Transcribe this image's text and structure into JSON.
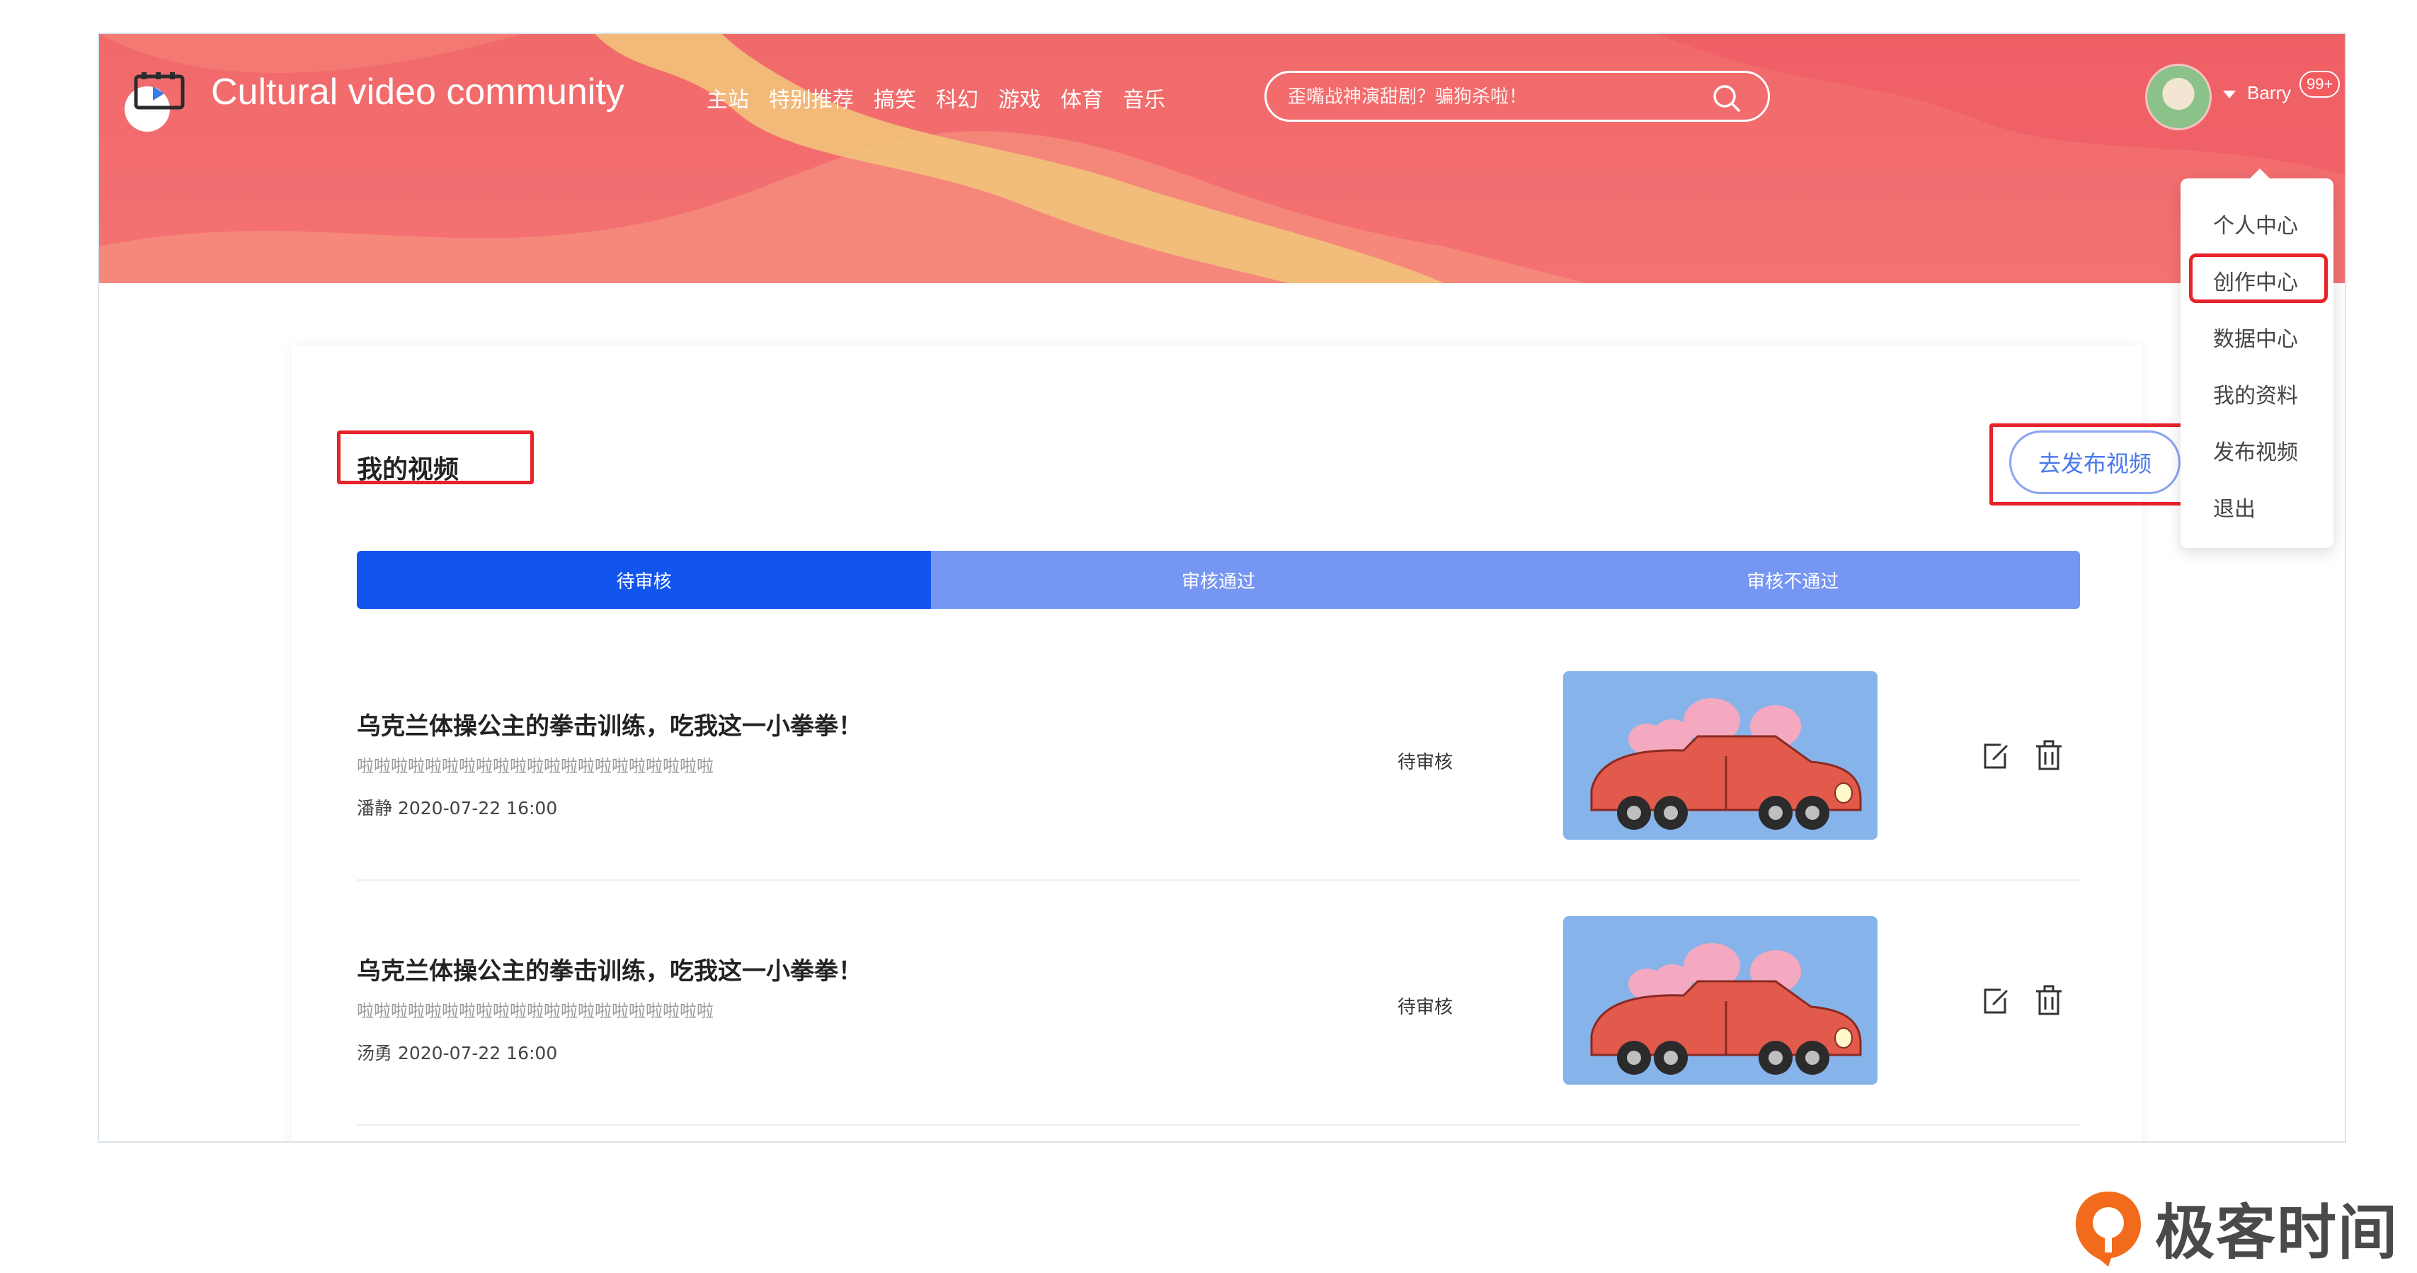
{
  "header": {
    "site_title": "Cultural video community",
    "nav": [
      "主站",
      "特别推荐",
      "搞笑",
      "科幻",
      "游戏",
      "体育",
      "音乐"
    ],
    "search": {
      "placeholder": "歪嘴战神演甜剧？骗狗杀啦！"
    },
    "user": {
      "name": "Barry",
      "badge": "99+"
    }
  },
  "dropdown": {
    "items": [
      "个人中心",
      "创作中心",
      "数据中心",
      "我的资料",
      "发布视频",
      "退出"
    ],
    "highlighted": "创作中心"
  },
  "main": {
    "title": "我的视频",
    "publish_label": "去发布视频",
    "tabs": [
      {
        "label": "待审核",
        "active": true
      },
      {
        "label": "审核通过",
        "active": false
      },
      {
        "label": "审核不通过",
        "active": false
      }
    ],
    "videos": [
      {
        "title": "乌克兰体操公主的拳击训练，吃我这一小拳拳！",
        "desc": "啦啦啦啦啦啦啦啦啦啦啦啦啦啦啦啦啦啦啦啦啦",
        "meta": "潘静 2020-07-22 16:00",
        "status": "待审核"
      },
      {
        "title": "乌克兰体操公主的拳击训练，吃我这一小拳拳！",
        "desc": "啦啦啦啦啦啦啦啦啦啦啦啦啦啦啦啦啦啦啦啦啦",
        "meta": "汤勇 2020-07-22 16:00",
        "status": "待审核"
      }
    ]
  },
  "watermark": {
    "text": "极客时间"
  },
  "colors": {
    "banner": "#f06a6a",
    "tab_active": "#1254ee",
    "tab_inactive": "#7596f3",
    "annotation_red": "#e8222a",
    "publish_text": "#4a78ee"
  }
}
